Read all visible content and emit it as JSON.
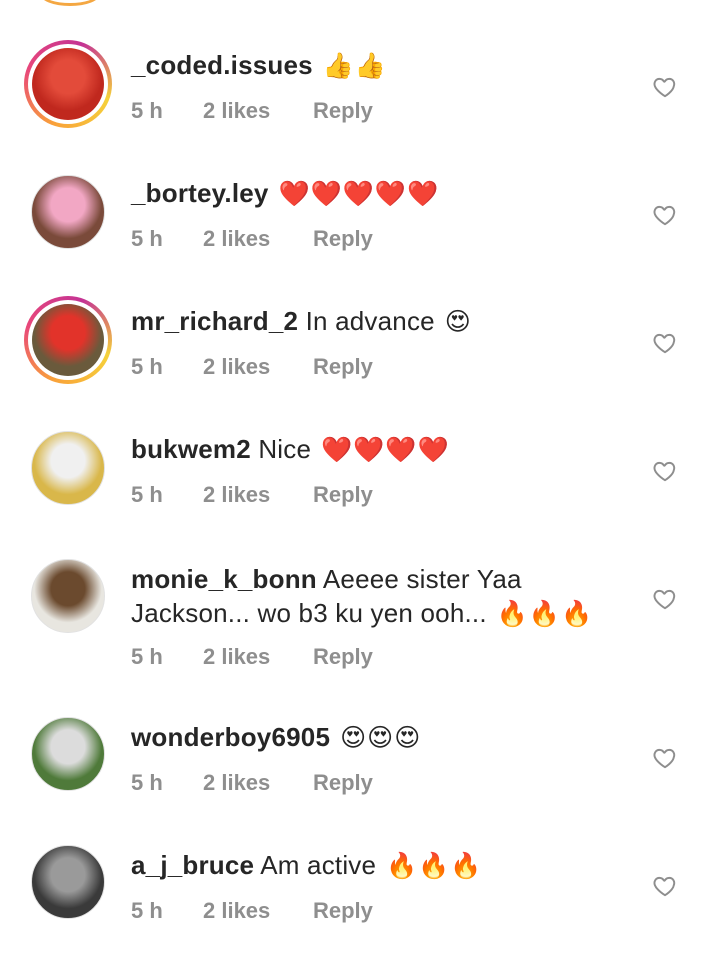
{
  "comments": [
    {
      "username": "_coded.issues",
      "text": "",
      "emoji": "👍👍",
      "time": "5 h",
      "likes": "2 likes",
      "reply": "Reply",
      "story": true,
      "avatar_bg": "#c0281e",
      "avatar_fg": "#e34b3a"
    },
    {
      "username": "_bortey.ley",
      "text": "",
      "emoji": "❤️❤️❤️❤️❤️",
      "time": "5 h",
      "likes": "2 likes",
      "reply": "Reply",
      "story": false,
      "avatar_bg": "#7a4a3a",
      "avatar_fg": "#f2a7c4"
    },
    {
      "username": "mr_richard_2",
      "text": "In advance",
      "emoji": "😍",
      "time": "5 h",
      "likes": "2 likes",
      "reply": "Reply",
      "story": true,
      "avatar_bg": "#6a5a3c",
      "avatar_fg": "#e2332a"
    },
    {
      "username": "bukwem2",
      "text": "Nice",
      "emoji": "❤️❤️❤️❤️",
      "time": "5 h",
      "likes": "2 likes",
      "reply": "Reply",
      "story": false,
      "avatar_bg": "#d9b74a",
      "avatar_fg": "#f0f0f0"
    },
    {
      "username": "monie_k_bonn",
      "text": "Aeeee sister Yaa Jackson... wo b3 ku yen ooh...",
      "emoji": "🔥🔥🔥",
      "time": "5 h",
      "likes": "2 likes",
      "reply": "Reply",
      "story": false,
      "avatar_bg": "#e8e6e0",
      "avatar_fg": "#6b4a2e"
    },
    {
      "username": "wonderboy6905",
      "text": "",
      "emoji": "😍😍😍",
      "time": "5 h",
      "likes": "2 likes",
      "reply": "Reply",
      "story": false,
      "avatar_bg": "#4f7a3a",
      "avatar_fg": "#dcdcdc"
    },
    {
      "username": "a_j_bruce",
      "text": "Am active",
      "emoji": "🔥🔥🔥",
      "time": "5 h",
      "likes": "2 likes",
      "reply": "Reply",
      "story": false,
      "avatar_bg": "#3a3a3a",
      "avatar_fg": "#9a9a9a"
    }
  ],
  "colors": {
    "text": "#262626",
    "meta": "#8e8e8e",
    "story_ring": "#e8477a"
  },
  "icons": {
    "like": "heart-outline-icon"
  }
}
